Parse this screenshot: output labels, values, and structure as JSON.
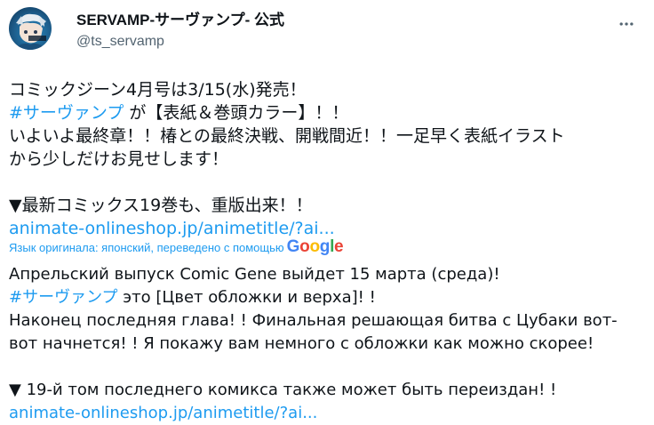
{
  "author": {
    "display_name": "SERVAMP-サーヴァンプ- 公式",
    "handle": "@ts_servamp"
  },
  "tweet": {
    "line1": "コミックジーン4月号は3/15(水)発売！",
    "hashtag1": "#サーヴァンプ",
    "line2_rest": " が【表紙＆巻頭カラー】！！",
    "line3": "いよいよ最終章！！椿との最終決戦、開戦間近！！一足早く表紙イラスト",
    "line4": "から少しだけお見せします！",
    "line5": "▼最新コミックス19巻も、重版出来！！",
    "link1": "animate-onlineshop.jp/animetitle/?ai..."
  },
  "translation": {
    "note": "Язык оригинала: японский, переведено с помощью",
    "provider": "Google",
    "line1": "Апрельский выпуск Comic Gene выйдет 15 марта (среда)!",
    "hashtag1": "#サーヴァンプ",
    "line2_rest": " это [Цвет обложки и верха]! !",
    "line3": "Наконец последняя глава! ! Финальная решающая битва с Цубаки вот-",
    "line4": "вот начнется! ! Я покажу вам немного с обложки как можно скорее!",
    "line5": "▼ 19-й том последнего комикса также может быть переиздан! !",
    "link1": "animate-onlineshop.jp/animetitle/?ai..."
  },
  "colors": {
    "link": "#1d9bf0",
    "text": "#0f1419",
    "secondary": "#536471"
  },
  "icons": {
    "more": "more-horizontal-icon",
    "avatar": "avatar-image"
  }
}
